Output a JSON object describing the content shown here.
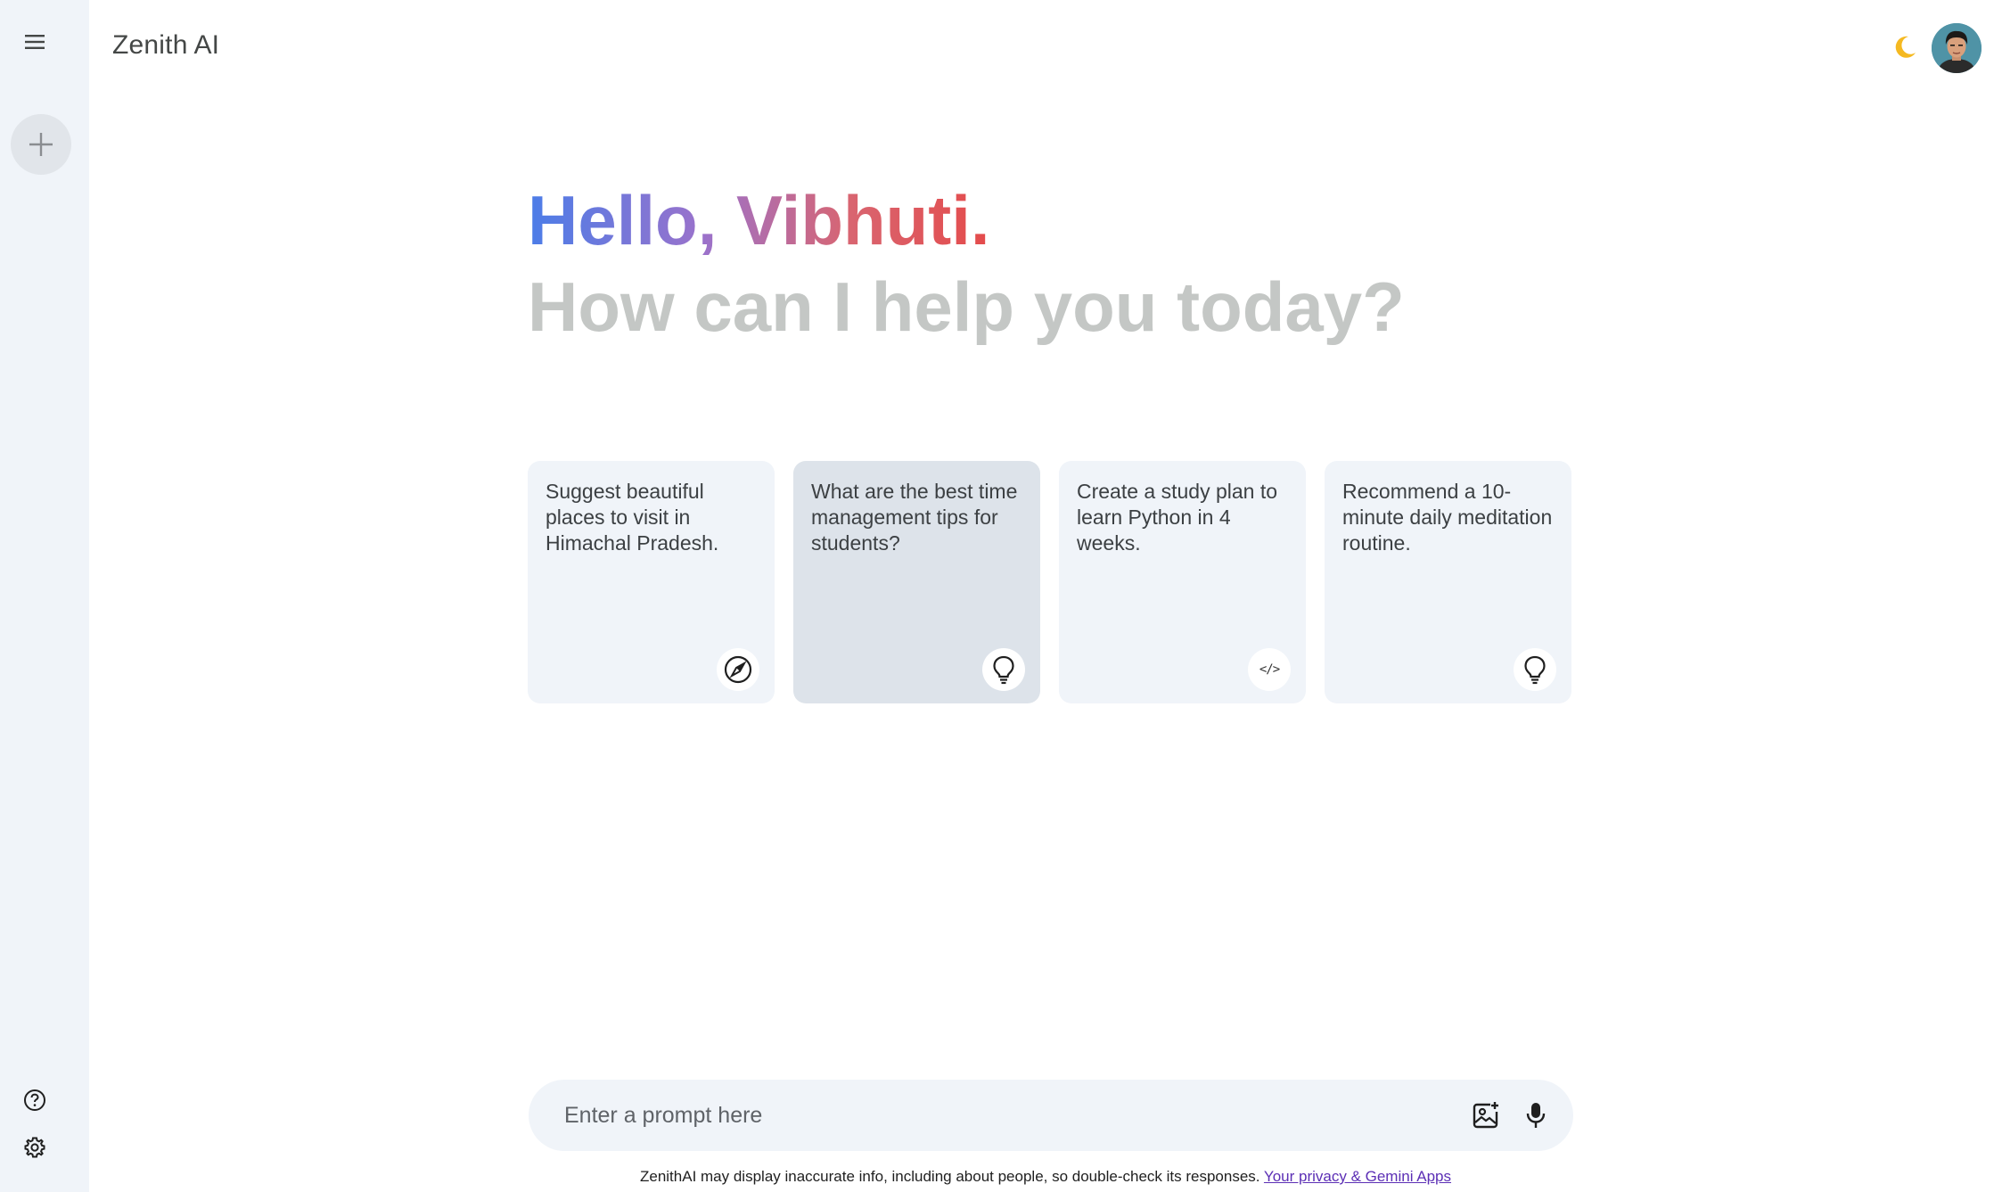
{
  "app": {
    "title": "Zenith AI"
  },
  "sidebar": {
    "menu_icon": "hamburger-menu-icon",
    "new_chat_icon": "plus-icon",
    "help_icon": "help-circle-icon",
    "settings_icon": "gear-icon"
  },
  "header": {
    "theme_toggle_glyph": "🌙",
    "theme_icon": "moon-icon",
    "avatar_icon": "user-avatar"
  },
  "greeting": {
    "hello": "Hello, Vibhuti.",
    "subtitle": "How can I help you today?",
    "gradient_colors": [
      "#4b7de8",
      "#9b72cb",
      "#d96570",
      "#e44b4b"
    ]
  },
  "cards": [
    {
      "text": "Suggest beautiful places to visit in Himachal Pradesh.",
      "icon": "compass-icon"
    },
    {
      "text": "What are the best time management tips for students?",
      "icon": "lightbulb-icon"
    },
    {
      "text": "Create a study plan to learn Python in 4 weeks.",
      "icon": "code-icon",
      "glyph": "</>"
    },
    {
      "text": "Recommend a 10-minute daily meditation routine.",
      "icon": "lightbulb-icon"
    }
  ],
  "prompt": {
    "placeholder": "Enter a prompt here",
    "value": "",
    "image_icon": "add-image-icon",
    "mic_icon": "microphone-icon"
  },
  "footer": {
    "disclaimer": "ZenithAI may display inaccurate info, including about people, so double-check its responses. ",
    "link_text": "Your privacy & Gemini Apps"
  },
  "colors": {
    "sidebar_bg": "#f0f4f9",
    "card_bg": "#f0f4f9",
    "card_active_bg": "#dde3ea",
    "subtitle": "#c4c7c5",
    "link": "#5c2fb5"
  }
}
